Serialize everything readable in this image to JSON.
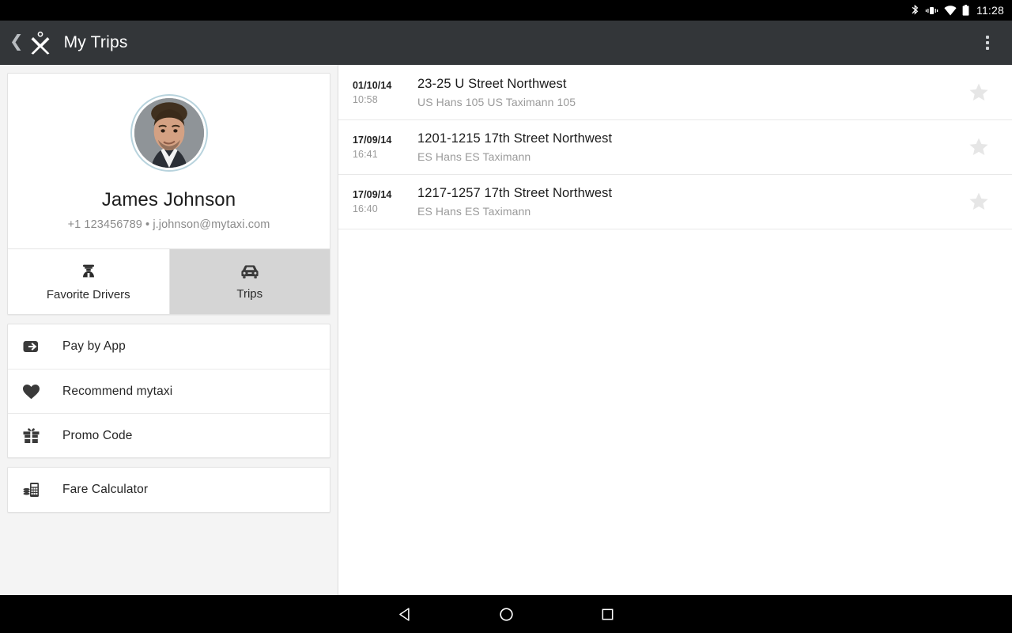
{
  "status_bar": {
    "time": "11:28",
    "icons": [
      "bluetooth-icon",
      "vibrate-icon",
      "wifi-icon",
      "battery-icon"
    ]
  },
  "app_bar": {
    "back_icon": "back-chevron-icon",
    "logo_icon": "mytaxi-logo-icon",
    "title": "My Trips",
    "overflow_icon": "overflow-menu-icon"
  },
  "profile": {
    "avatar_icon": "user-avatar-photo",
    "name": "James Johnson",
    "contact": "+1 123456789 • j.johnson@mytaxi.com"
  },
  "tabs": [
    {
      "label": "Favorite Drivers",
      "icon": "driver-icon",
      "selected": false
    },
    {
      "label": "Trips",
      "icon": "taxi-icon",
      "selected": true
    }
  ],
  "menu": {
    "group_one": [
      {
        "label": "Pay by App",
        "icon": "pay-by-app-icon"
      },
      {
        "label": "Recommend mytaxi",
        "icon": "heart-icon"
      },
      {
        "label": "Promo Code",
        "icon": "gift-icon"
      }
    ],
    "group_two": [
      {
        "label": "Fare Calculator",
        "icon": "calculator-icon"
      }
    ]
  },
  "trips": [
    {
      "date": "01/10/14",
      "time": "10:58",
      "address": "23-25 U Street Northwest",
      "driver": "US Hans 105 US Taximann 105",
      "star_icon": "star-icon",
      "favorited": false
    },
    {
      "date": "17/09/14",
      "time": "16:41",
      "address": "1201-1215 17th Street Northwest",
      "driver": "ES Hans ES Taximann",
      "star_icon": "star-icon",
      "favorited": false
    },
    {
      "date": "17/09/14",
      "time": "16:40",
      "address": "1217-1257 17th Street Northwest",
      "driver": "ES Hans ES Taximann",
      "star_icon": "star-icon",
      "favorited": false
    }
  ],
  "nav_bar": {
    "buttons": [
      {
        "icon": "android-back-icon"
      },
      {
        "icon": "android-home-icon"
      },
      {
        "icon": "android-recents-icon"
      }
    ]
  },
  "colors": {
    "appbar_bg": "#333639",
    "left_pane_bg": "#f4f4f4",
    "tab_selected_bg": "#d5d5d5",
    "avatar_ring": "#b8d3dd",
    "star_inactive": "#e6e6e6"
  }
}
